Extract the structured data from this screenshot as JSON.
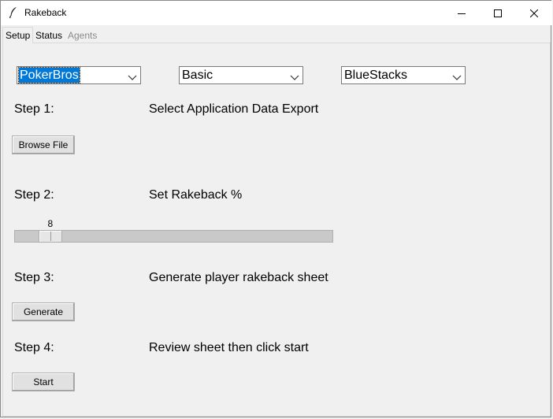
{
  "window": {
    "title": "Rakeback"
  },
  "tabs": [
    {
      "label": "Setup",
      "active": true,
      "enabled": true
    },
    {
      "label": "Status",
      "active": false,
      "enabled": true
    },
    {
      "label": "Agents",
      "active": false,
      "enabled": false
    }
  ],
  "selectors": {
    "platform": "PokerBros",
    "mode": "Basic",
    "emulator": "BlueStacks"
  },
  "steps": [
    {
      "step": "Step 1:",
      "description": "Select Application Data Export",
      "button": "Browse File"
    },
    {
      "step": "Step 2:",
      "description": "Set Rakeback %"
    },
    {
      "step": "Step 3:",
      "description": "Generate player rakeback sheet",
      "button": "Generate"
    },
    {
      "step": "Step 4:",
      "description": "Review sheet then click start",
      "button": "Start"
    }
  ],
  "rakeback_slider": {
    "value": "8",
    "min": 0,
    "max": 100
  },
  "icons": {
    "app": "feather-icon",
    "minimize": "minimize-icon",
    "maximize": "maximize-icon",
    "close": "close-icon",
    "dropdown": "chevron-down-icon"
  }
}
